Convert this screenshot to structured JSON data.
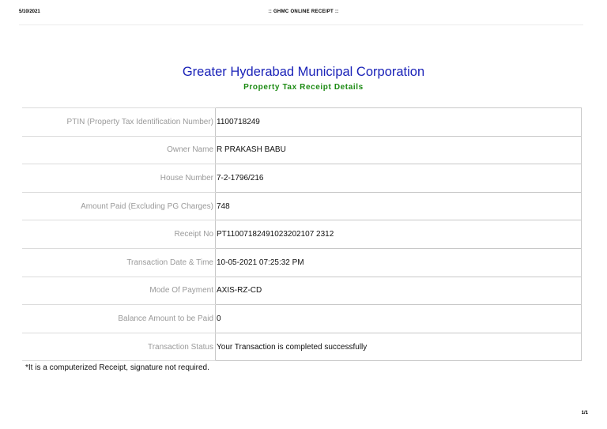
{
  "print_header": {
    "date": "5/10/2021",
    "title": ":: GHMC ONLINE RECEIPT ::"
  },
  "header": {
    "org_name": "Greater Hyderabad Municipal Corporation",
    "subtitle": "Property Tax Receipt Details"
  },
  "rows": [
    {
      "label": "PTIN (Property Tax Identification Number)",
      "value": "1100718249"
    },
    {
      "label": "Owner Name",
      "value": "R PRAKASH BABU"
    },
    {
      "label": "House Number",
      "value": "7-2-1796/216"
    },
    {
      "label": "Amount Paid (Excluding PG Charges)",
      "value": "748"
    },
    {
      "label": "Receipt No",
      "value": "PT11007182491023202107 2312"
    },
    {
      "label": "Transaction Date & Time",
      "value": "10-05-2021 07:25:32 PM"
    },
    {
      "label": "Mode Of Payment",
      "value": "AXIS-RZ-CD"
    },
    {
      "label": "Balance Amount to be Paid",
      "value": "0"
    },
    {
      "label": "Transaction Status",
      "value": "Your Transaction is completed successfully"
    }
  ],
  "footer": {
    "note": "*It is a computerized Receipt, signature not required.",
    "page": "1/1"
  }
}
